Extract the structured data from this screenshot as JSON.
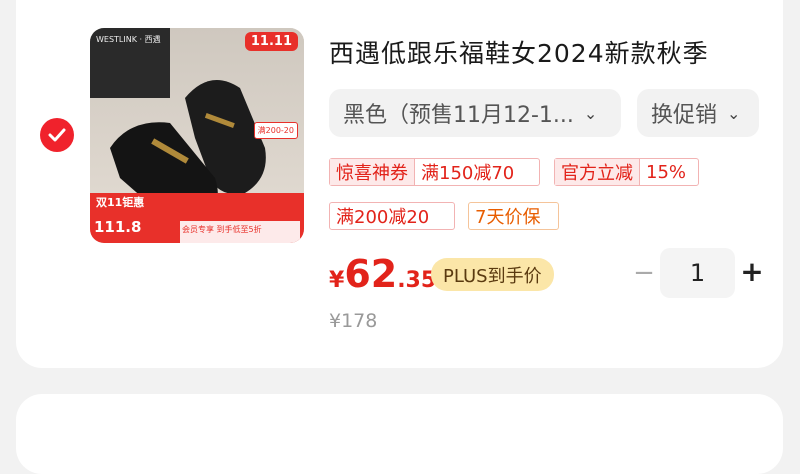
{
  "product": {
    "title": "西遇低跟乐福鞋女2024新款秋季",
    "spec": "黑色（预售11月12-1...",
    "promo": "换促销",
    "price_symbol": "¥",
    "price_int": "62",
    "price_dec": ".35",
    "plus_badge": "PLUS到手价",
    "original_price": "¥178",
    "quantity": "1"
  },
  "tags": {
    "coupon_label": "惊喜神券",
    "coupon_value": "满150减70",
    "discount_label": "官方立减",
    "discount_value": "15%",
    "reduce": "满200减20",
    "guarantee": "7天价保"
  },
  "thumbnail": {
    "brand": "WESTLINK · 西遇",
    "badge": "11.11",
    "bottom_title": "双11钜惠",
    "bottom_price": "111.8",
    "bottom_note": "会员专享 到手低至5折",
    "mini_tag": "满200-20"
  },
  "colors": {
    "accent": "#e2231a",
    "check": "#f0222c",
    "plus_badge_bg": "#fbe6a8"
  }
}
